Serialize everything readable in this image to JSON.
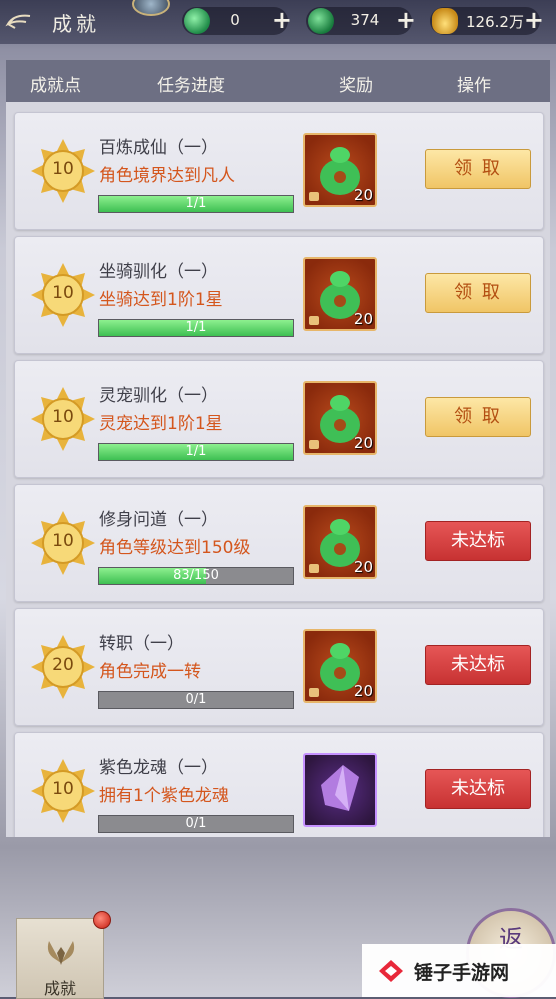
{
  "header": {
    "title": "成就",
    "resources": [
      {
        "name": "jade",
        "value": "0"
      },
      {
        "name": "bound-jade",
        "value": "374"
      },
      {
        "name": "gold",
        "value": "126.2万"
      }
    ],
    "plus_symbol": "+"
  },
  "table": {
    "columns": [
      "成就点",
      "任务进度",
      "奖励",
      "操作"
    ]
  },
  "rows": [
    {
      "points": "10",
      "name": "百炼成仙（一）",
      "desc": "角色境界达到凡人",
      "progress_text": "1/1",
      "progress": 1.0,
      "reward_count": "20",
      "reward_type": "jade-bag",
      "action": "领 取",
      "action_state": "claim"
    },
    {
      "points": "10",
      "name": "坐骑驯化（一）",
      "desc": "坐骑达到1阶1星",
      "progress_text": "1/1",
      "progress": 1.0,
      "reward_count": "20",
      "reward_type": "jade-bag",
      "action": "领 取",
      "action_state": "claim"
    },
    {
      "points": "10",
      "name": "灵宠驯化（一）",
      "desc": "灵宠达到1阶1星",
      "progress_text": "1/1",
      "progress": 1.0,
      "reward_count": "20",
      "reward_type": "jade-bag",
      "action": "领 取",
      "action_state": "claim"
    },
    {
      "points": "10",
      "name": "修身问道（一）",
      "desc": "角色等级达到150级",
      "progress_text": "83/150",
      "progress": 0.553,
      "reward_count": "20",
      "reward_type": "jade-bag",
      "action": "未达标",
      "action_state": "locked"
    },
    {
      "points": "20",
      "name": "转职（一）",
      "desc": "角色完成一转",
      "progress_text": "0/1",
      "progress": 0,
      "reward_count": "20",
      "reward_type": "jade-bag",
      "action": "未达标",
      "action_state": "locked"
    },
    {
      "points": "10",
      "name": "紫色龙魂（一）",
      "desc": "拥有1个紫色龙魂",
      "progress_text": "0/1",
      "progress": 0,
      "reward_count": "",
      "reward_type": "purple-crystal",
      "action": "未达标",
      "action_state": "locked"
    }
  ],
  "bottom": {
    "tab_label": "成就",
    "return_label": "返",
    "watermark": "锤子手游网"
  },
  "colors": {
    "claim_button": "#f0c566",
    "locked_button": "#d23a3a",
    "progress_fill": "#3ebf52",
    "desc_text": "#d4561d"
  }
}
